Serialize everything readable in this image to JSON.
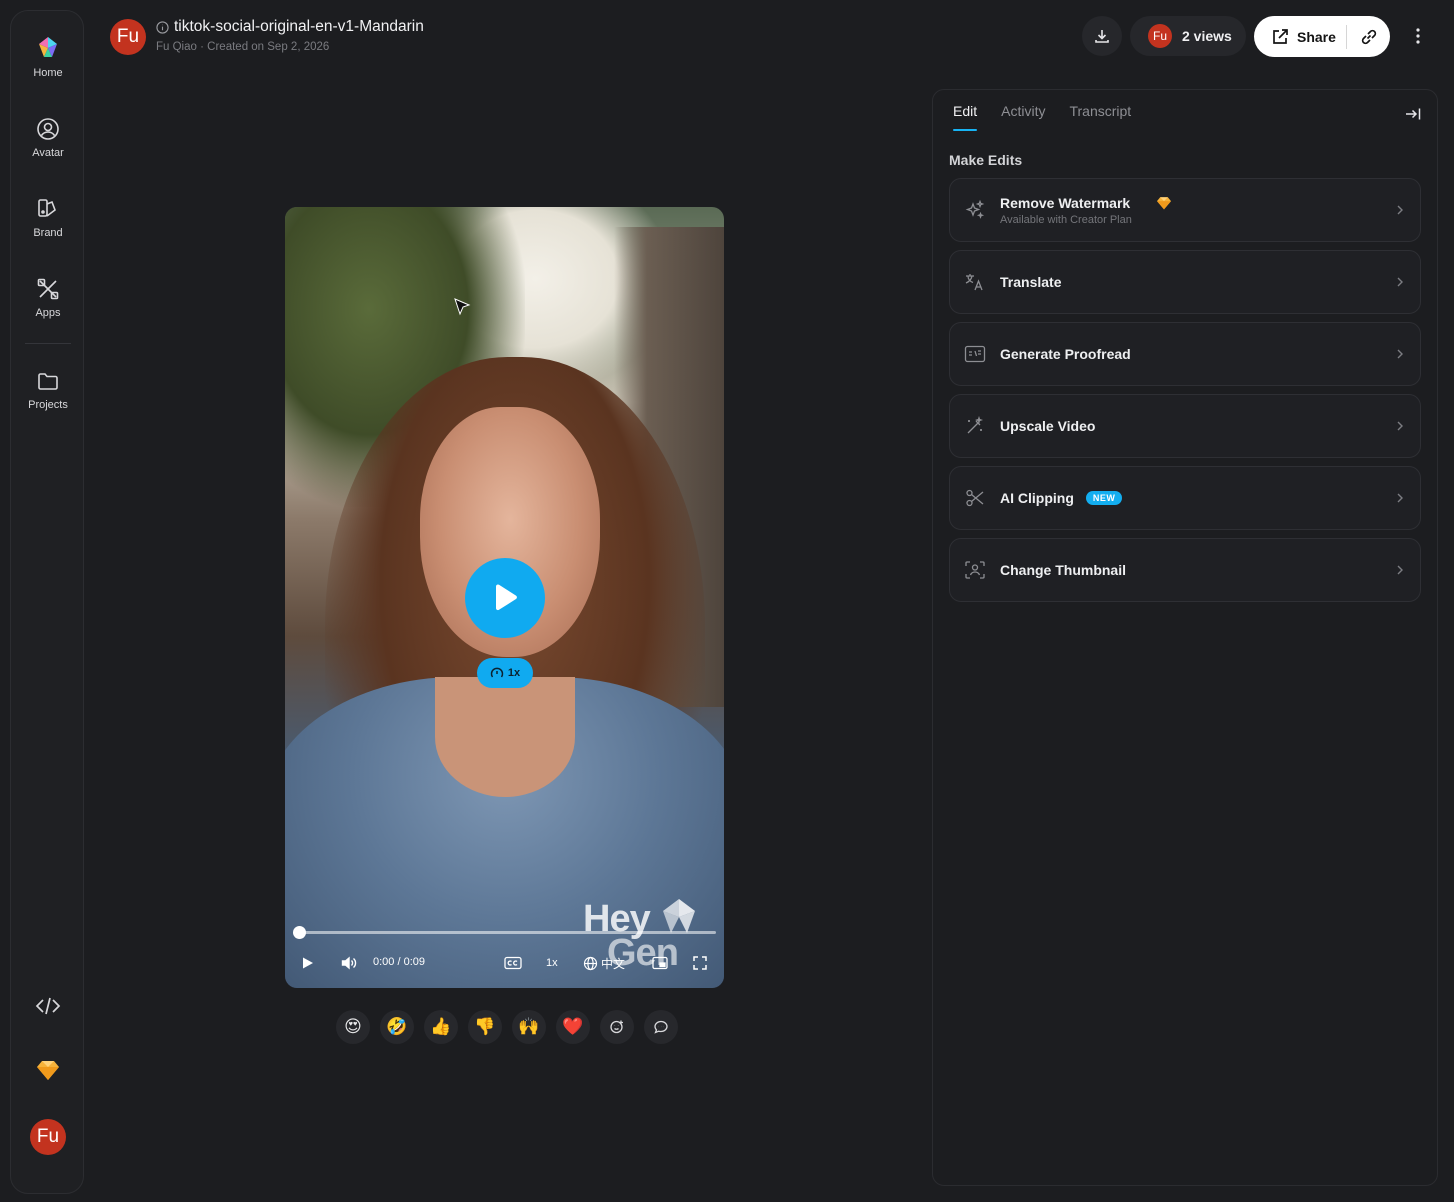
{
  "sidebar": {
    "items": [
      {
        "label": "Home",
        "icon": "heygen-logo-icon"
      },
      {
        "label": "Avatar",
        "icon": "avatar-icon"
      },
      {
        "label": "Brand",
        "icon": "brand-icon"
      },
      {
        "label": "Apps",
        "icon": "apps-icon"
      },
      {
        "label": "Projects",
        "icon": "folder-icon"
      }
    ],
    "user_initials": "Fu"
  },
  "header": {
    "avatar_initials": "Fu",
    "title": "tiktok-social-original-en-v1-Mandarin",
    "author": "Fu Qiao",
    "created": "Created on Sep 2, 2026",
    "separator": "·",
    "views_avatar": "Fu",
    "views_label": "2 views",
    "share_label": "Share"
  },
  "video": {
    "speed_badge": "1x",
    "watermark_line1": "Hey",
    "watermark_line2": "Gen",
    "current_time": "0:00",
    "time_separator": "/",
    "duration": "0:09",
    "speed_control": "1x",
    "language": "中文",
    "progress": 0
  },
  "reactions": [
    "😍",
    "🤣",
    "👍",
    "👎",
    "🙌",
    "❤️"
  ],
  "panel": {
    "tabs": [
      "Edit",
      "Activity",
      "Transcript"
    ],
    "active_tab": "Edit",
    "section_title": "Make Edits",
    "edits": [
      {
        "label": "Remove Watermark",
        "sub": "Available with Creator Plan",
        "icon": "sparkle-icon",
        "premium": true
      },
      {
        "label": "Translate",
        "icon": "translate-icon"
      },
      {
        "label": "Generate Proofread",
        "icon": "proofread-icon"
      },
      {
        "label": "Upscale Video",
        "icon": "magic-wand-icon"
      },
      {
        "label": "AI Clipping",
        "icon": "scissors-icon",
        "badge": "NEW"
      },
      {
        "label": "Change Thumbnail",
        "icon": "thumbnail-icon"
      }
    ]
  },
  "colors": {
    "accent": "#10aaf0",
    "avatar": "#c3331f",
    "background": "#1c1d20"
  }
}
